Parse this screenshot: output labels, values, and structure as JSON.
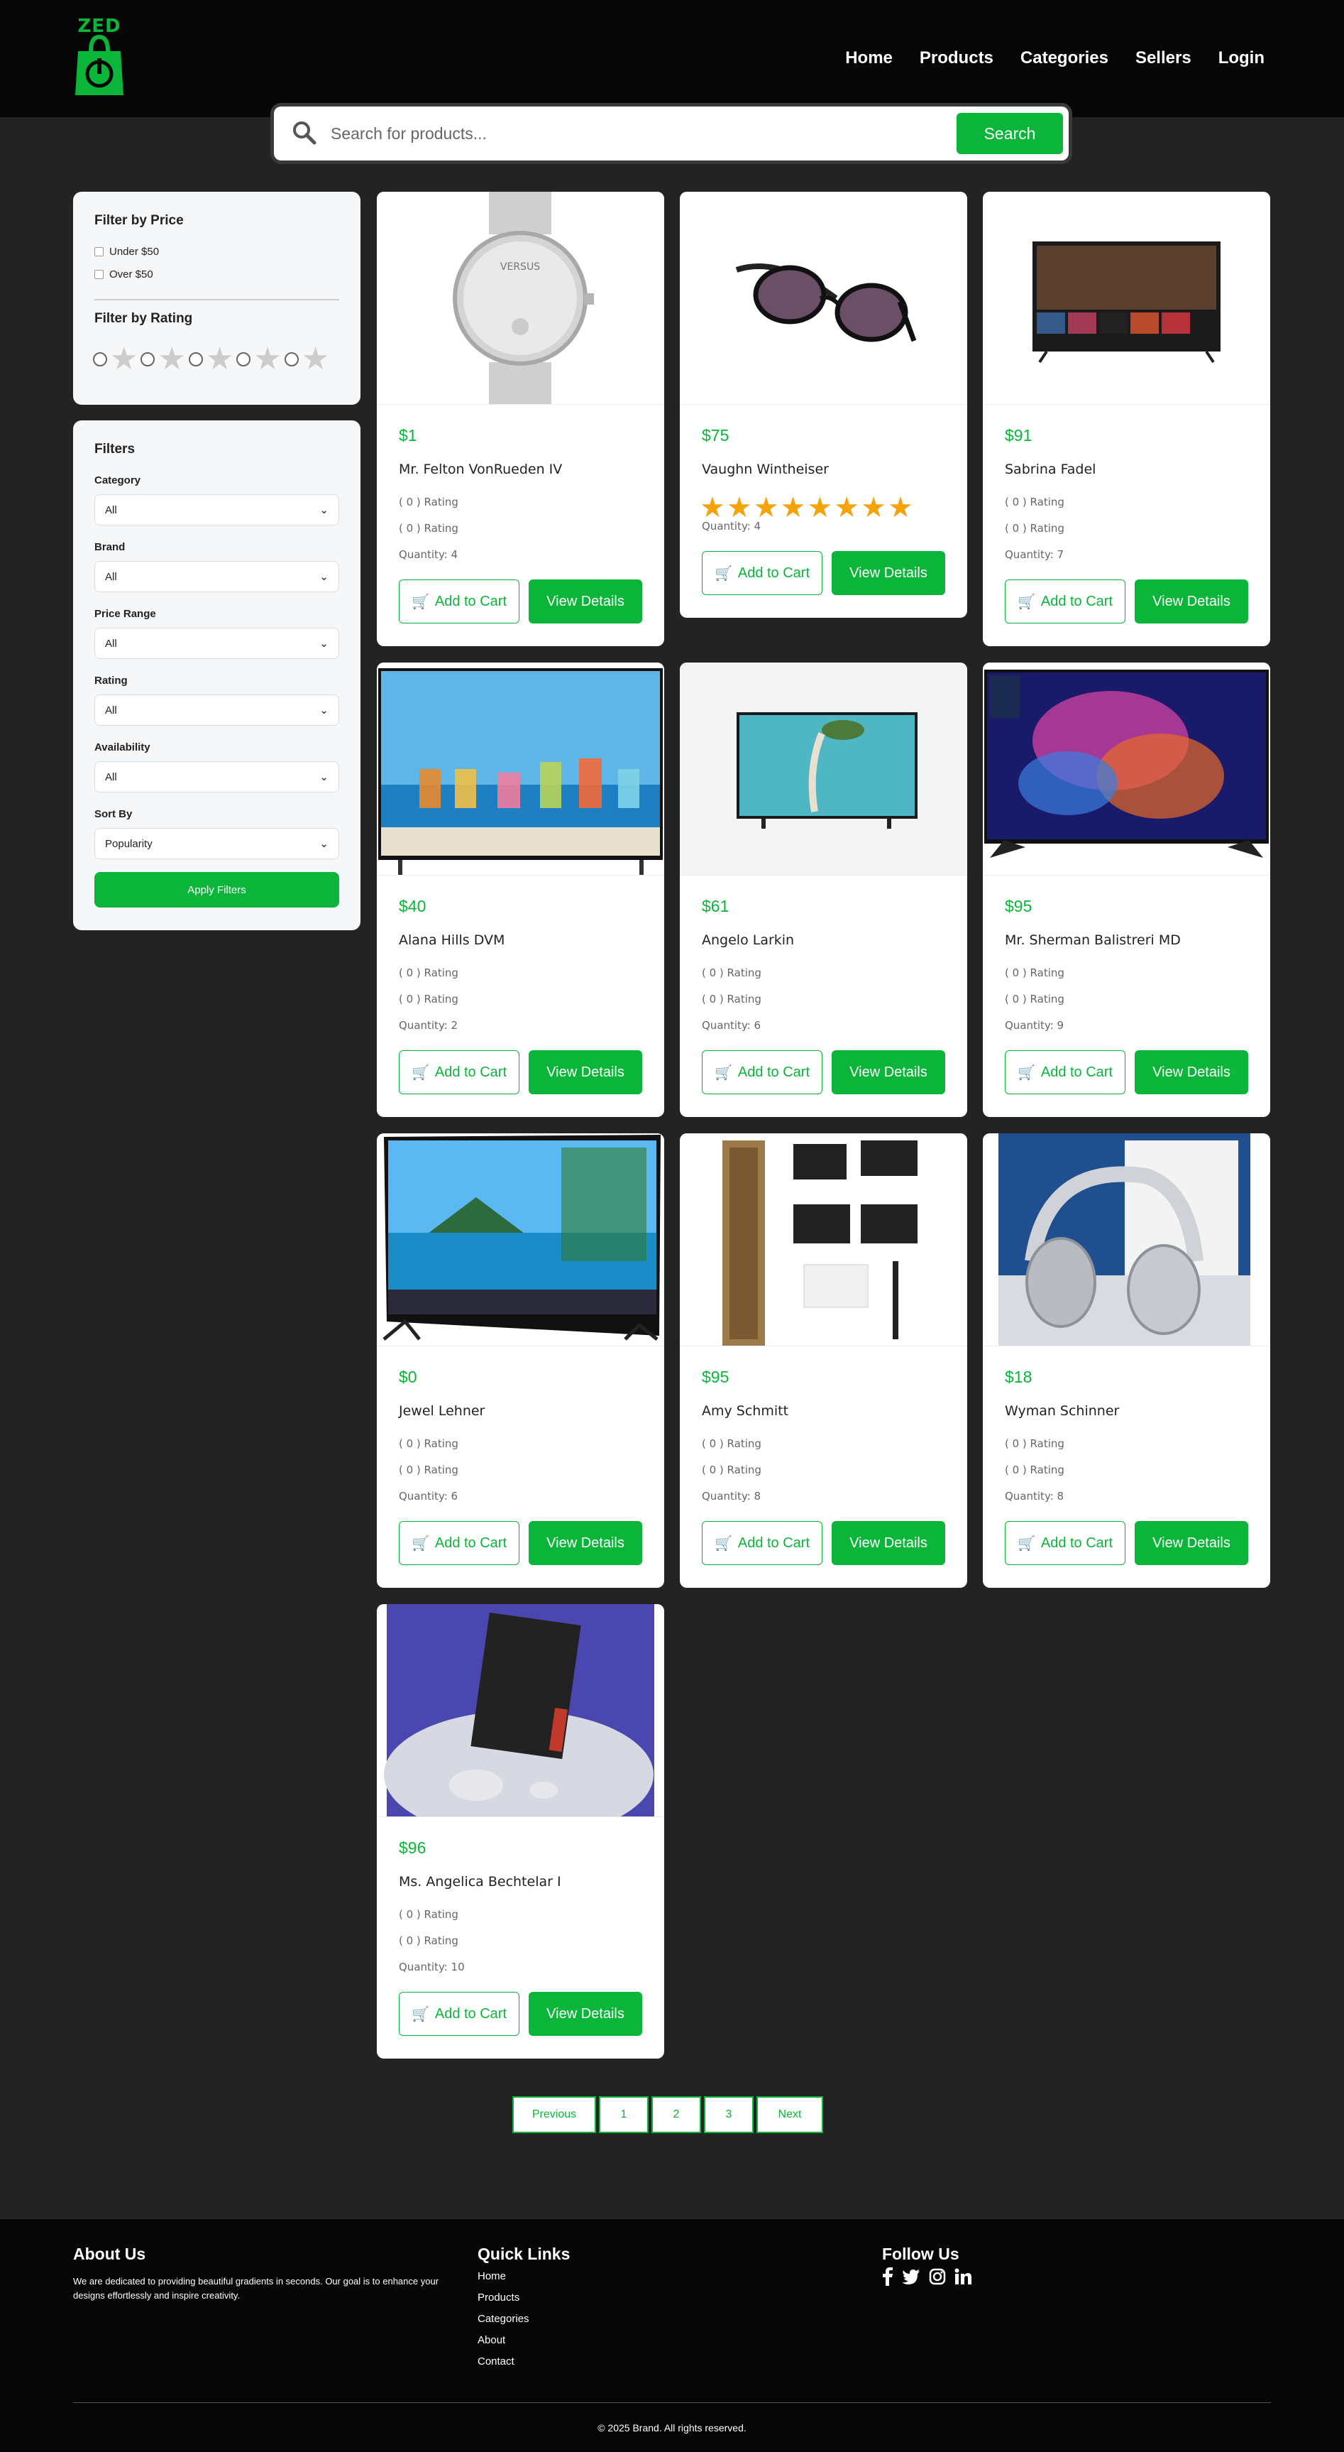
{
  "brand": {
    "logo_text": "ZED"
  },
  "nav": {
    "items": [
      "Home",
      "Products",
      "Categories",
      "Sellers",
      "Login"
    ]
  },
  "search": {
    "placeholder": "Search for products...",
    "button": "Search"
  },
  "price_filter": {
    "title": "Filter by Price",
    "options": [
      "Under $50",
      "Over $50"
    ],
    "rating_title": "Filter by Rating"
  },
  "filters": {
    "title": "Filters",
    "fields": [
      {
        "label": "Category",
        "value": "All"
      },
      {
        "label": "Brand",
        "value": "All"
      },
      {
        "label": "Price Range",
        "value": "All"
      },
      {
        "label": "Rating",
        "value": "All"
      },
      {
        "label": "Availability",
        "value": "All"
      },
      {
        "label": "Sort By",
        "value": "Popularity"
      }
    ],
    "apply": "Apply Filters"
  },
  "card_labels": {
    "add_to_cart": "Add to Cart",
    "view_details": "View Details"
  },
  "products": [
    {
      "price": "$1",
      "name": "Mr. Felton VonRueden IV",
      "rating1": "( 0 ) Rating",
      "rating2": "( 0 ) Rating",
      "quantity": "Quantity: 4",
      "image": "watch",
      "stars": 0
    },
    {
      "price": "$75",
      "name": "Vaughn Wintheiser",
      "quantity": "Quantity: 4",
      "image": "sunglasses",
      "stars": 8
    },
    {
      "price": "$91",
      "name": "Sabrina Fadel",
      "rating1": "( 0 ) Rating",
      "rating2": "( 0 ) Rating",
      "quantity": "Quantity: 7",
      "image": "tv-dragon",
      "stars": 0
    },
    {
      "price": "$40",
      "name": "Alana Hills DVM",
      "rating1": "( 0 ) Rating",
      "rating2": "( 0 ) Rating",
      "quantity": "Quantity: 2",
      "image": "tv-cocktails",
      "stars": 0
    },
    {
      "price": "$61",
      "name": "Angelo Larkin",
      "rating1": "( 0 ) Rating",
      "rating2": "( 0 ) Rating",
      "quantity": "Quantity: 6",
      "image": "tv-beach",
      "stars": 0
    },
    {
      "price": "$95",
      "name": "Mr. Sherman Balistreri MD",
      "rating1": "( 0 ) Rating",
      "rating2": "( 0 ) Rating",
      "quantity": "Quantity: 9",
      "image": "tv-hisense",
      "stars": 0
    },
    {
      "price": "$0",
      "name": "Jewel Lehner",
      "rating1": "( 0 ) Rating",
      "rating2": "( 0 ) Rating",
      "quantity": "Quantity: 6",
      "image": "tv-lg",
      "stars": 0
    },
    {
      "price": "$95",
      "name": "Amy Schmitt",
      "rating1": "( 0 ) Rating",
      "rating2": "( 0 ) Rating",
      "quantity": "Quantity: 8",
      "image": "trimmer",
      "stars": 0
    },
    {
      "price": "$18",
      "name": "Wyman Schinner",
      "rating1": "( 0 ) Rating",
      "rating2": "( 0 ) Rating",
      "quantity": "Quantity: 8",
      "image": "headphones",
      "stars": 0
    },
    {
      "price": "$96",
      "name": "Ms. Angelica Bechtelar I",
      "rating1": "( 0 ) Rating",
      "rating2": "( 0 ) Rating",
      "quantity": "Quantity: 10",
      "image": "earbuds",
      "stars": 0
    }
  ],
  "pagination": {
    "items": [
      "Previous",
      "1",
      "2",
      "3",
      "Next"
    ]
  },
  "footer": {
    "about_title": "About Us",
    "about_text": "We are dedicated to providing beautiful gradients in seconds. Our goal is to enhance your designs effortlessly and inspire creativity.",
    "links_title": "Quick Links",
    "links": [
      "Home",
      "Products",
      "Categories",
      "About",
      "Contact"
    ],
    "follow_title": "Follow Us",
    "social": [
      "facebook-icon",
      "twitter-icon",
      "instagram-icon",
      "linkedin-icon"
    ],
    "copyright": "© 2025 Brand. All rights reserved."
  },
  "colors": {
    "accent": "#0bb53a",
    "header_bg": "#060606",
    "page_bg": "#232323",
    "star": "#f5a30a"
  }
}
